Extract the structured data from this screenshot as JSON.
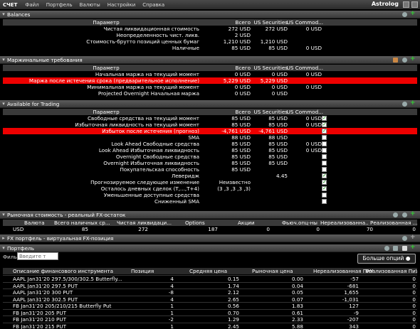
{
  "menubar": {
    "account": "СЧЕТ",
    "items": [
      "Файл",
      "Портфель",
      "Валюты",
      "Настройки",
      "Справка"
    ],
    "brand": "Astrolog"
  },
  "balances": {
    "title": "Balances",
    "headers": [
      "Параметр",
      "Всего",
      "US Securities",
      "US Commod..."
    ],
    "rows": [
      {
        "param": "Чистая ликвидационная стоимость",
        "total": "272 USD",
        "sec": "272 USD",
        "com": "0 USD"
      },
      {
        "param": "Неопределенность чист. ликв.",
        "total": "2 USD",
        "sec": "",
        "com": ""
      },
      {
        "param": "Стоимость-брутто позиций ценных бумаг",
        "total": "1,210 USD",
        "sec": "1,210 USD",
        "com": ""
      },
      {
        "param": "Наличные",
        "total": "85 USD",
        "sec": "85 USD",
        "com": "0 USD"
      }
    ]
  },
  "margin": {
    "title": "Маржинальные требования",
    "headers": [
      "Параметр",
      "Всего",
      "US Securities",
      "US Commod..."
    ],
    "rows": [
      {
        "param": "Начальная маржа на текущий момент",
        "total": "0 USD",
        "sec": "0 USD",
        "com": "0 USD",
        "red": false
      },
      {
        "param": "Маржа после истечения срока (предварительное исполнение)",
        "total": "5,229 USD",
        "sec": "5,229 USD",
        "com": "",
        "red": true
      },
      {
        "param": "Минимальная маржа на текущий момент",
        "total": "0 USD",
        "sec": "0 USD",
        "com": "0 USD",
        "red": false
      },
      {
        "param": "Projected Overnight Начальная маржа",
        "total": "0 USD",
        "sec": "0 USD",
        "com": "",
        "red": false
      }
    ]
  },
  "trading": {
    "title": "Available for Trading",
    "headers": [
      "Параметр",
      "Всего",
      "US Securities",
      "US Commod..."
    ],
    "rows": [
      {
        "param": "Свободные средства на текущий момент",
        "total": "85 USD",
        "sec": "85 USD",
        "com": "0 USD",
        "red": false,
        "check": true
      },
      {
        "param": "Избыточная ликвидность на текущий момент",
        "total": "85 USD",
        "sec": "85 USD",
        "com": "0 USD",
        "red": false,
        "check": true
      },
      {
        "param": "Избыток после истечения (прогноз)",
        "total": "-4,761 USD",
        "sec": "-4,761 USD",
        "com": "",
        "red": true,
        "check": true
      },
      {
        "param": "SMA",
        "total": "88 USD",
        "sec": "88 USD",
        "com": "",
        "red": false,
        "check": false
      },
      {
        "param": "Look Ahead Свободные средства",
        "total": "85 USD",
        "sec": "85 USD",
        "com": "0 USD",
        "red": false,
        "check": false
      },
      {
        "param": "Look Ahead Избыточная ликвидность",
        "total": "85 USD",
        "sec": "85 USD",
        "com": "0 USD",
        "red": false,
        "check": false
      },
      {
        "param": "Overnight Свободные средства",
        "total": "85 USD",
        "sec": "85 USD",
        "com": "",
        "red": false,
        "check": false
      },
      {
        "param": "Overnight Избыточная ликвидность",
        "total": "85 USD",
        "sec": "85 USD",
        "com": "",
        "red": false,
        "check": false
      },
      {
        "param": "Покупательская способность",
        "total": "85 USD",
        "sec": "",
        "com": "",
        "red": false,
        "check": false
      },
      {
        "param": "Леверидж",
        "total": "",
        "sec": "4.45",
        "com": "",
        "red": false,
        "check": true
      },
      {
        "param": "Прогнозируемое следующее изменение",
        "total": "Неизвестно",
        "sec": "",
        "com": "",
        "red": false,
        "check": true
      },
      {
        "param": "Осталось дневных сделок (Т,...,Т+4)",
        "total": "(3 ,3 ,3 ,3 ,3)",
        "sec": "",
        "com": "",
        "red": false,
        "check": true
      },
      {
        "param": "Уменьшенные доступные средства",
        "total": "",
        "sec": "",
        "com": "",
        "red": false,
        "check": false
      },
      {
        "param": "Сниженный SMA",
        "total": "",
        "sec": "",
        "com": "",
        "red": false,
        "check": false
      }
    ]
  },
  "fx_market": {
    "title": "Рыночная стоимость - реальный FX-остаток",
    "headers": [
      "Валюта",
      "Всего наличных ср...",
      "Чистая ликвидаци...",
      "Options",
      "Акции",
      "Фьюч.опц-ны",
      "Нереализованна...",
      "Реализованная ..."
    ],
    "row": [
      "USD",
      "85",
      "272",
      "187",
      "0",
      "0",
      "70",
      "0"
    ]
  },
  "fx_portfolio": {
    "title": "FX портфель - виртуальная FX-позиция"
  },
  "portfolio": {
    "title": "Портфель",
    "filter_label": "Фильтр",
    "filter_placeholder": "Введите т",
    "more_options": "Больше опций",
    "headers": [
      "Описание финансового инструмента",
      "Позиция",
      "Средняя цена",
      "Рыночная цена",
      "Нереализованная ПиУ",
      "Реализованная ПиУ"
    ],
    "rows": [
      {
        "desc": "AAPL Jan31'20 297.5/300/302.5 Butterfly...",
        "pos": "4",
        "avg": "0.15",
        "mkt": "0.00",
        "unreal": "-57",
        "real": "0"
      },
      {
        "desc": "AAPL Jan31'20 297.5 PUT",
        "pos": "4",
        "avg": "1.74",
        "mkt": "0.04",
        "unreal": "-681",
        "real": "0"
      },
      {
        "desc": "AAPL Jan31'20 300 PUT",
        "pos": "-8",
        "avg": "2.12",
        "mkt": "0.05",
        "unreal": "1,655",
        "real": "0"
      },
      {
        "desc": "AAPL Jan31'20 302.5 PUT",
        "pos": "4",
        "avg": "2.65",
        "mkt": "0.07",
        "unreal": "-1,031",
        "real": "0"
      },
      {
        "desc": "FB Jan31'20 205/210/215 Butterfly Put",
        "pos": "1",
        "avg": "0.56",
        "mkt": "1.83",
        "unreal": "127",
        "real": "0"
      },
      {
        "desc": "FB Jan31'20 205 PUT",
        "pos": "1",
        "avg": "0.70",
        "mkt": "0.61",
        "unreal": "-9",
        "real": "0"
      },
      {
        "desc": "FB Jan31'20 210 PUT",
        "pos": "-2",
        "avg": "1.29",
        "mkt": "2.33",
        "unreal": "-207",
        "real": "0"
      },
      {
        "desc": "FB Jan31'20 215 PUT",
        "pos": "1",
        "avg": "2.45",
        "mkt": "5.88",
        "unreal": "343",
        "real": "0"
      }
    ]
  },
  "colors": {
    "alert_red": "#e00000",
    "header_gray": "#4a4a4a",
    "check_green": "#008800"
  }
}
